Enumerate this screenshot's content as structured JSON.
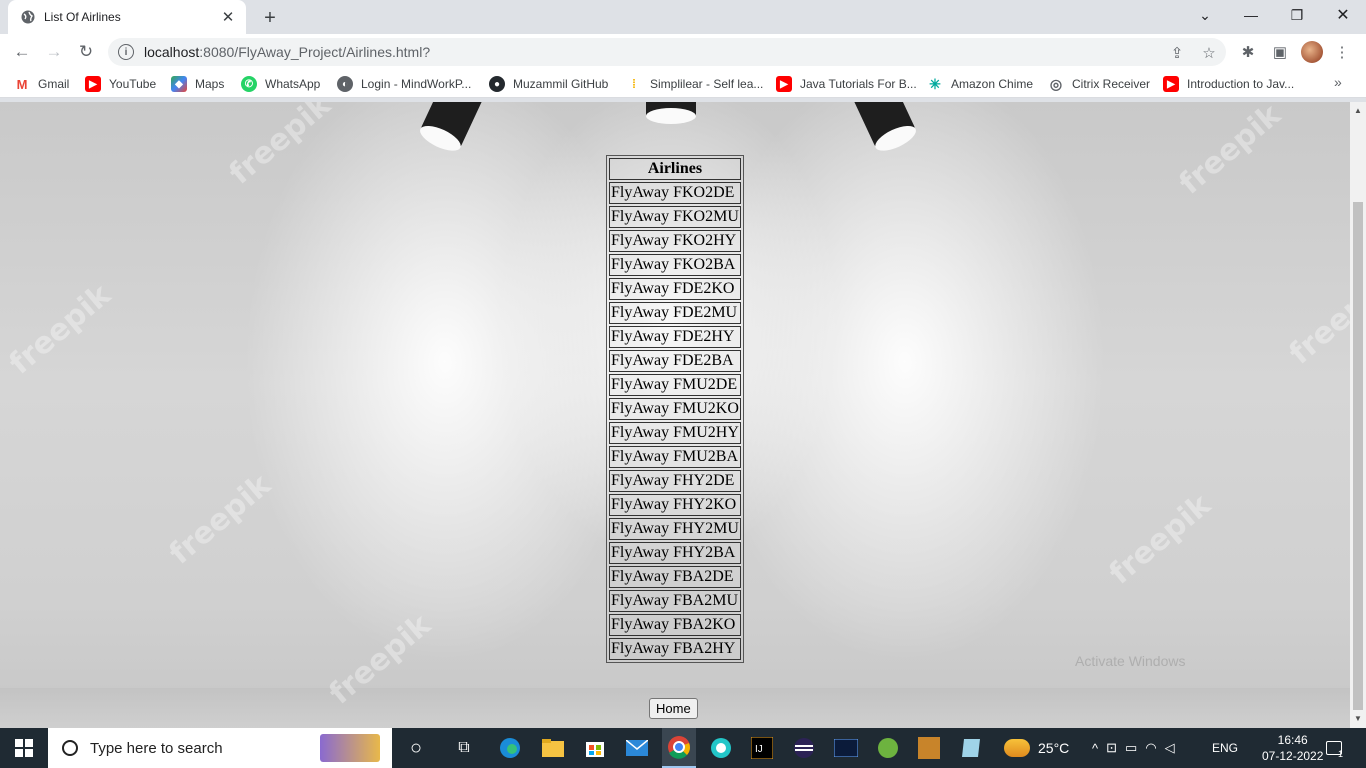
{
  "browser": {
    "tab_title": "List Of Airlines",
    "url_host": "localhost",
    "url_path": ":8080/FlyAway_Project/Airlines.html?",
    "bookmarks": [
      {
        "label": "Gmail",
        "color": "#ffffff"
      },
      {
        "label": "YouTube",
        "color": "#ff0000"
      },
      {
        "label": "Maps",
        "color": "#34a853"
      },
      {
        "label": "WhatsApp",
        "color": "#25d366"
      },
      {
        "label": "Login - MindWorkP...",
        "color": "#5f6368"
      },
      {
        "label": "Muzammil GitHub",
        "color": "#24292e"
      },
      {
        "label": "Simplilear - Self lea...",
        "color": "#f4b400"
      },
      {
        "label": "Java Tutorials For B...",
        "color": "#ff0000"
      },
      {
        "label": "Amazon Chime",
        "color": "#00a99d"
      },
      {
        "label": "Citrix Receiver",
        "color": "#5f6368"
      },
      {
        "label": "Introduction to Jav...",
        "color": "#ff0000"
      }
    ]
  },
  "page": {
    "table_header": "Airlines",
    "airlines": [
      "FlyAway FKO2DE",
      "FlyAway FKO2MU",
      "FlyAway FKO2HY",
      "FlyAway FKO2BA",
      "FlyAway FDE2KO",
      "FlyAway FDE2MU",
      "FlyAway FDE2HY",
      "FlyAway FDE2BA",
      "FlyAway FMU2DE",
      "FlyAway FMU2KO",
      "FlyAway FMU2HY",
      "FlyAway FMU2BA",
      "FlyAway FHY2DE",
      "FlyAway FHY2KO",
      "FlyAway FHY2MU",
      "FlyAway FHY2BA",
      "FlyAway FBA2DE",
      "FlyAway FBA2MU",
      "FlyAway FBA2KO",
      "FlyAway FBA2HY"
    ],
    "home_button": "Home",
    "watermark_text": "freepik",
    "activate_windows": "Activate Windows"
  },
  "taskbar": {
    "search_placeholder": "Type here to search",
    "weather": "25°C",
    "language": "ENG",
    "time": "16:46",
    "date": "07-12-2022",
    "notification_count": "1"
  }
}
